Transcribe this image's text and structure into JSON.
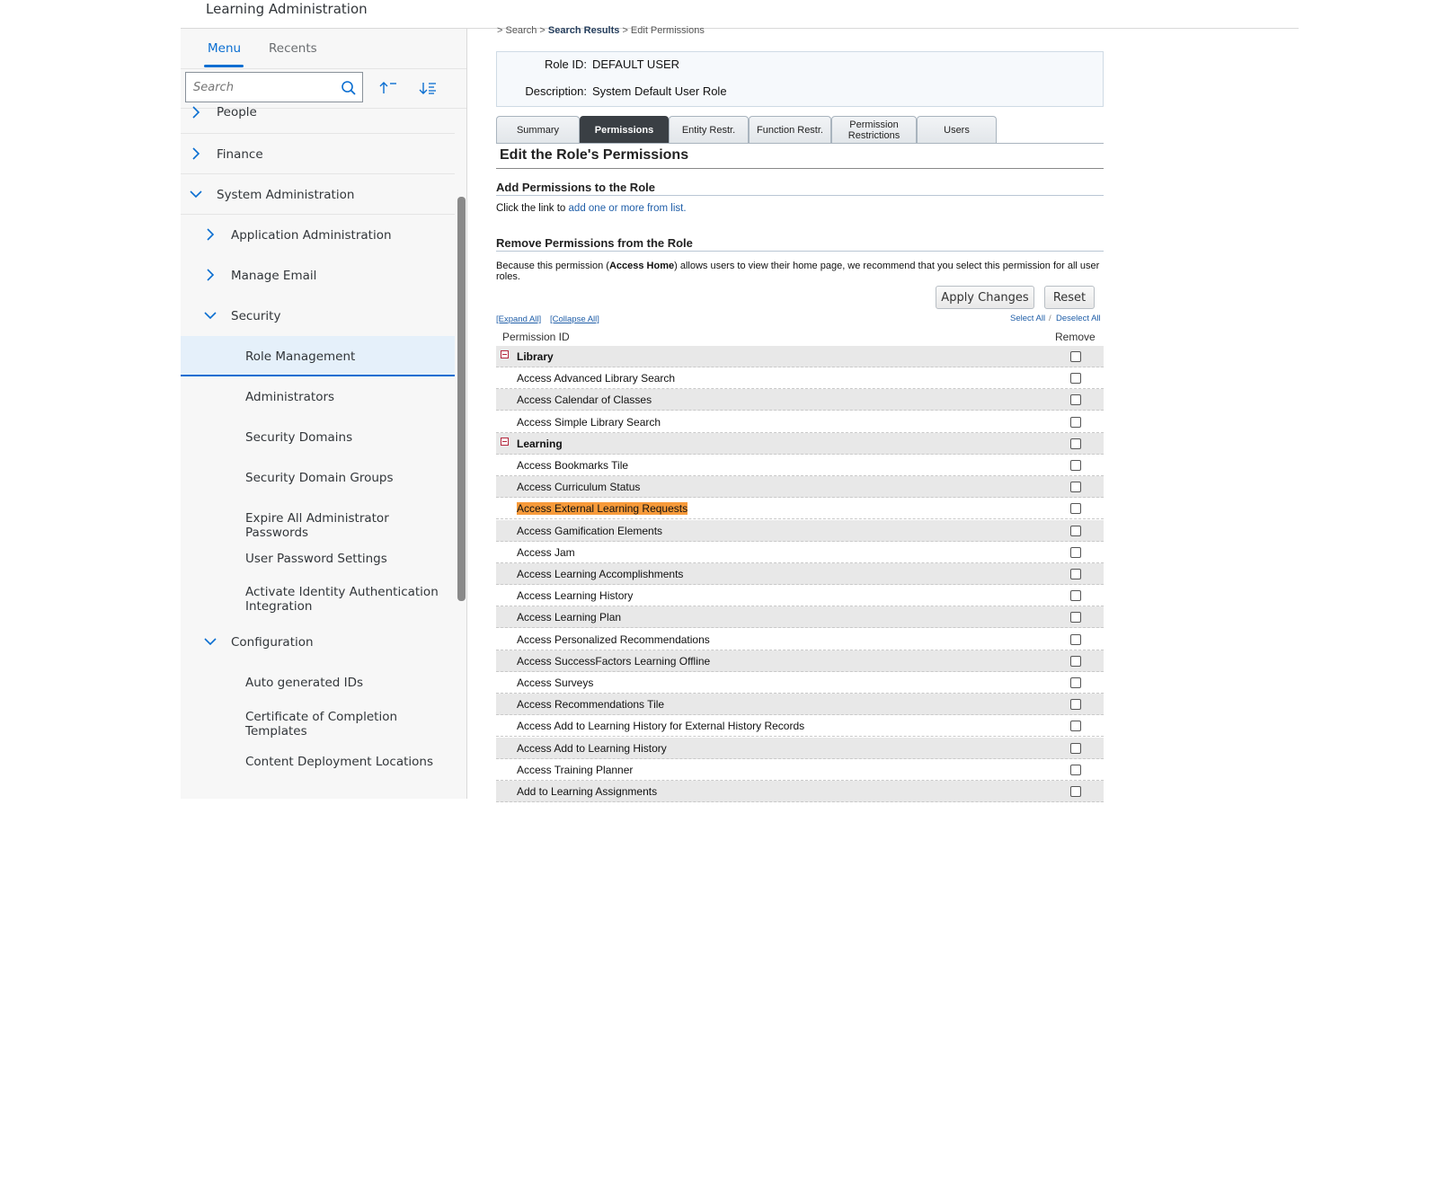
{
  "app": {
    "title": "Learning Administration"
  },
  "sidebar": {
    "tabs": {
      "menu": "Menu",
      "recents": "Recents"
    },
    "search_placeholder": "Search",
    "items": [
      {
        "label": "People"
      },
      {
        "label": "Finance"
      },
      {
        "label": "System Administration"
      },
      {
        "label": "Application Administration"
      },
      {
        "label": "Manage Email"
      },
      {
        "label": "Security"
      },
      {
        "label": "Role Management"
      },
      {
        "label": "Administrators"
      },
      {
        "label": "Security Domains"
      },
      {
        "label": "Security Domain Groups"
      },
      {
        "label": "Expire All Administrator Passwords"
      },
      {
        "label": "User Password Settings"
      },
      {
        "label": "Activate Identity Authentication",
        "label2": "Integration"
      },
      {
        "label": "Configuration"
      },
      {
        "label": "Auto generated IDs"
      },
      {
        "label": "Certificate of Completion",
        "label2": "Templates"
      },
      {
        "label": "Content Deployment Locations"
      }
    ]
  },
  "breadcrumb": {
    "prefix": "> Search >",
    "results": "Search Results",
    "current": "> Edit Permissions"
  },
  "role": {
    "id_label": "Role ID:",
    "id": "DEFAULT USER",
    "desc_label": "Description:",
    "desc": "System Default User Role"
  },
  "tabs": [
    {
      "label": "Summary"
    },
    {
      "label": "Permissions"
    },
    {
      "label": "Entity Restr."
    },
    {
      "label": "Function Restr."
    },
    {
      "label": "Permission",
      "label2": "Restrictions"
    },
    {
      "label": "Users"
    }
  ],
  "edit": {
    "title": "Edit the Role's Permissions",
    "add_title": "Add Permissions to the Role",
    "add_text": "Click the link to ",
    "add_link": "add one or more from list.",
    "remove_title": "Remove Permissions from the Role",
    "remove_desc_a": "Because this permission (",
    "remove_desc_bold": "Access Home",
    "remove_desc_b": ") allows users to view their home page, we recommend that you select this permission for all user roles.",
    "apply": "Apply Changes",
    "reset": "Reset",
    "expand_all": "[Expand All]",
    "collapse_all": "[Collapse All]",
    "select_all": "Select All",
    "deselect_all": "Deselect All"
  },
  "table": {
    "col_id": "Permission ID",
    "col_remove": "Remove",
    "rows": [
      {
        "name": "Library",
        "group": true
      },
      {
        "name": "Access Advanced Library Search"
      },
      {
        "name": "Access Calendar of Classes"
      },
      {
        "name": "Access Simple Library Search"
      },
      {
        "name": "Learning",
        "group": true
      },
      {
        "name": "Access Bookmarks Tile"
      },
      {
        "name": "Access Curriculum Status"
      },
      {
        "name": "Access External Learning Requests",
        "highlight": true
      },
      {
        "name": "Access Gamification Elements"
      },
      {
        "name": "Access Jam"
      },
      {
        "name": "Access Learning Accomplishments"
      },
      {
        "name": "Access Learning History"
      },
      {
        "name": "Access Learning Plan"
      },
      {
        "name": "Access Personalized Recommendations"
      },
      {
        "name": "Access SuccessFactors Learning Offline"
      },
      {
        "name": "Access Surveys"
      },
      {
        "name": "Access Recommendations Tile"
      },
      {
        "name": "Access Add to Learning History for External History Records"
      },
      {
        "name": "Access Add to Learning History"
      },
      {
        "name": "Access Training Planner"
      },
      {
        "name": "Add to Learning Assignments"
      }
    ]
  },
  "colors": {
    "accent": "#0a6ed1",
    "highlight": "#f79a3a",
    "active_tab": "#3a3f44"
  }
}
